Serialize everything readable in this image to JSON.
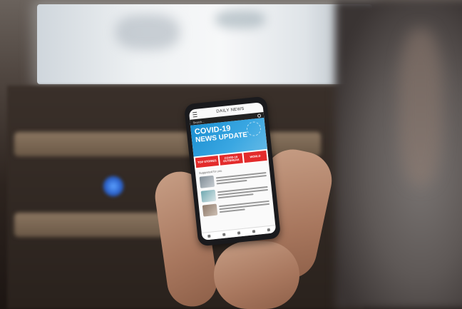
{
  "app": {
    "title": "DAILY NEWS",
    "search_placeholder": "Search..."
  },
  "banner": {
    "line1": "COVID-19",
    "line2": "NEWS UPDATE"
  },
  "tiles": [
    "TOP STORIES",
    "COVID-19 OUTBREAK",
    "WORLD"
  ],
  "section": {
    "title": "Suggested for you"
  },
  "tabs": [
    "home-icon",
    "bookmark-icon",
    "search-icon",
    "plus-icon",
    "profile-icon"
  ],
  "colors": {
    "banner_blue": "#1b8fd1",
    "accent_red": "#e32b2b",
    "led_blue": "#2a5fc8"
  }
}
